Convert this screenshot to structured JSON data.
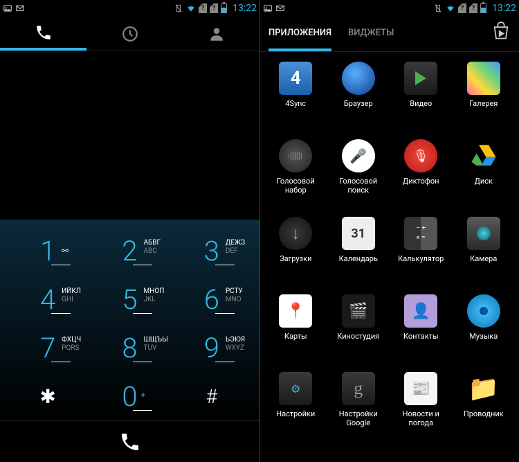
{
  "status": {
    "time": "13:22"
  },
  "dialer": {
    "keys": {
      "1": {
        "digit": "1"
      },
      "2": {
        "digit": "2",
        "letters_ru": "АБВГ",
        "letters_en": "ABC"
      },
      "3": {
        "digit": "3",
        "letters_ru": "ДЕЖЗ",
        "letters_en": "DEF"
      },
      "4": {
        "digit": "4",
        "letters_ru": "ИЙКЛ",
        "letters_en": "GHI"
      },
      "5": {
        "digit": "5",
        "letters_ru": "МНОП",
        "letters_en": "JKL"
      },
      "6": {
        "digit": "6",
        "letters_ru": "РСТУ",
        "letters_en": "MNO"
      },
      "7": {
        "digit": "7",
        "letters_ru": "ФХЦЧ",
        "letters_en": "PQRS"
      },
      "8": {
        "digit": "8",
        "letters_ru": "ШЩЪЫ",
        "letters_en": "TUV"
      },
      "9": {
        "digit": "9",
        "letters_ru": "ЬЭЮЯ",
        "letters_en": "WXYZ"
      },
      "star": {
        "symbol": "✱"
      },
      "0": {
        "digit": "0",
        "plus": "+"
      },
      "pound": {
        "symbol": "#"
      }
    }
  },
  "drawer": {
    "tabs": {
      "apps": "ПРИЛОЖЕНИЯ",
      "widgets": "ВИДЖЕТЫ"
    },
    "apps": [
      {
        "name": "4Sync",
        "icon": "i-4sync"
      },
      {
        "name": "Браузер",
        "icon": "i-browser"
      },
      {
        "name": "Видео",
        "icon": "i-video"
      },
      {
        "name": "Галерея",
        "icon": "i-gallery"
      },
      {
        "name": "Голосовой набор",
        "icon": "i-voicedial"
      },
      {
        "name": "Голосовой поиск",
        "icon": "i-voicesearch"
      },
      {
        "name": "Диктофон",
        "icon": "i-recorder"
      },
      {
        "name": "Диск",
        "icon": "i-drive"
      },
      {
        "name": "Загрузки",
        "icon": "i-downloads"
      },
      {
        "name": "Календарь",
        "icon": "i-calendar"
      },
      {
        "name": "Калькулятор",
        "icon": "i-calc"
      },
      {
        "name": "Камера",
        "icon": "i-camera"
      },
      {
        "name": "Карты",
        "icon": "i-maps"
      },
      {
        "name": "Киностудия",
        "icon": "i-movie"
      },
      {
        "name": "Контакты",
        "icon": "i-contacts"
      },
      {
        "name": "Музыка",
        "icon": "i-music"
      },
      {
        "name": "Настройки",
        "icon": "i-settings"
      },
      {
        "name": "Настройки Google",
        "icon": "i-gsettings"
      },
      {
        "name": "Новости и погода",
        "icon": "i-news"
      },
      {
        "name": "Проводник",
        "icon": "i-files"
      }
    ]
  }
}
